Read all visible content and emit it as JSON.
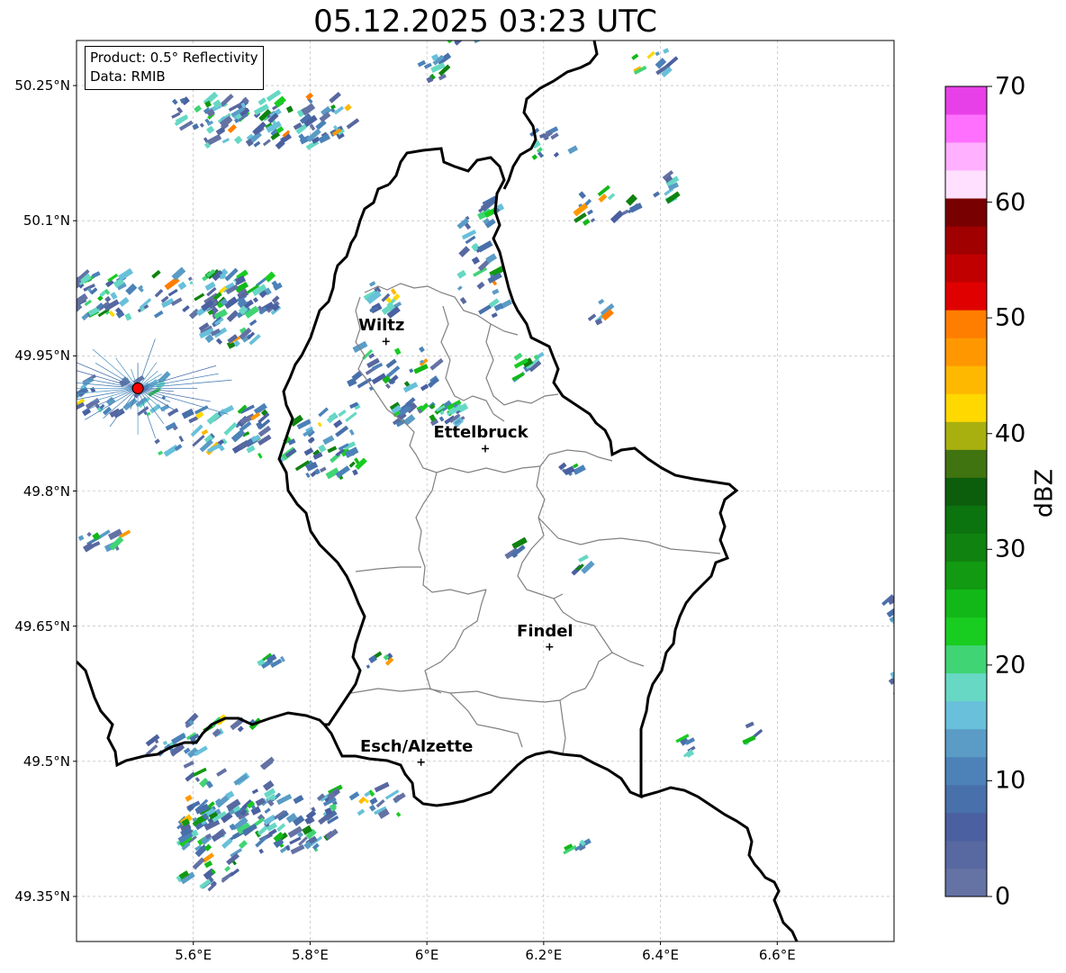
{
  "title": "05.12.2025 03:23 UTC",
  "info": {
    "product": "Product: 0.5° Reflectivity",
    "data": "Data: RMIB"
  },
  "map": {
    "lon_range": [
      5.4,
      6.8
    ],
    "lat_range": [
      49.3,
      50.3
    ],
    "lat_ticks": [
      {
        "value": 50.25,
        "label": "50.25°N"
      },
      {
        "value": 50.1,
        "label": "50.1°N"
      },
      {
        "value": 49.95,
        "label": "49.95°N"
      },
      {
        "value": 49.8,
        "label": "49.8°N"
      },
      {
        "value": 49.65,
        "label": "49.65°N"
      },
      {
        "value": 49.5,
        "label": "49.5°N"
      },
      {
        "value": 49.35,
        "label": "49.35°N"
      }
    ],
    "lon_ticks": [
      {
        "value": 5.6,
        "label": "5.6°E"
      },
      {
        "value": 5.8,
        "label": "5.8°E"
      },
      {
        "value": 6.0,
        "label": "6°E"
      },
      {
        "value": 6.2,
        "label": "6.2°E"
      },
      {
        "value": 6.4,
        "label": "6.4°E"
      },
      {
        "value": 6.6,
        "label": "6.6°E"
      }
    ],
    "cities": [
      {
        "name": "Wiltz",
        "lon": 5.93,
        "lat": 49.966
      },
      {
        "name": "Ettelbruck",
        "lon": 6.1,
        "lat": 49.847
      },
      {
        "name": "Findel",
        "lon": 6.21,
        "lat": 49.627
      },
      {
        "name": "Esch/Alzette",
        "lon": 5.99,
        "lat": 49.499
      }
    ],
    "radar_site": {
      "lon": 5.505,
      "lat": 49.914
    }
  },
  "colorbar": {
    "label": "dBZ",
    "min": 0,
    "max": 70,
    "ticks": [
      {
        "value": 70,
        "label": "70"
      },
      {
        "value": 60,
        "label": "60"
      },
      {
        "value": 50,
        "label": "50"
      },
      {
        "value": 40,
        "label": "40"
      },
      {
        "value": 30,
        "label": "30"
      },
      {
        "value": 20,
        "label": "20"
      },
      {
        "value": 10,
        "label": "10"
      },
      {
        "value": 0,
        "label": "0"
      }
    ],
    "colors": [
      "#6472a4",
      "#5868a0",
      "#4a60a0",
      "#4870aa",
      "#4c82b8",
      "#5a9cc6",
      "#68c0da",
      "#66d8c4",
      "#40d474",
      "#18cc20",
      "#12b818",
      "#129a12",
      "#108210",
      "#0c740e",
      "#0c5e0c",
      "#407410",
      "#a8b010",
      "#ffd800",
      "#ffb800",
      "#ff9800",
      "#ff7e00",
      "#e00000",
      "#c00000",
      "#a00000",
      "#780000",
      "#ffe0ff",
      "#ffb0ff",
      "#ff70ff",
      "#e840e8"
    ]
  }
}
